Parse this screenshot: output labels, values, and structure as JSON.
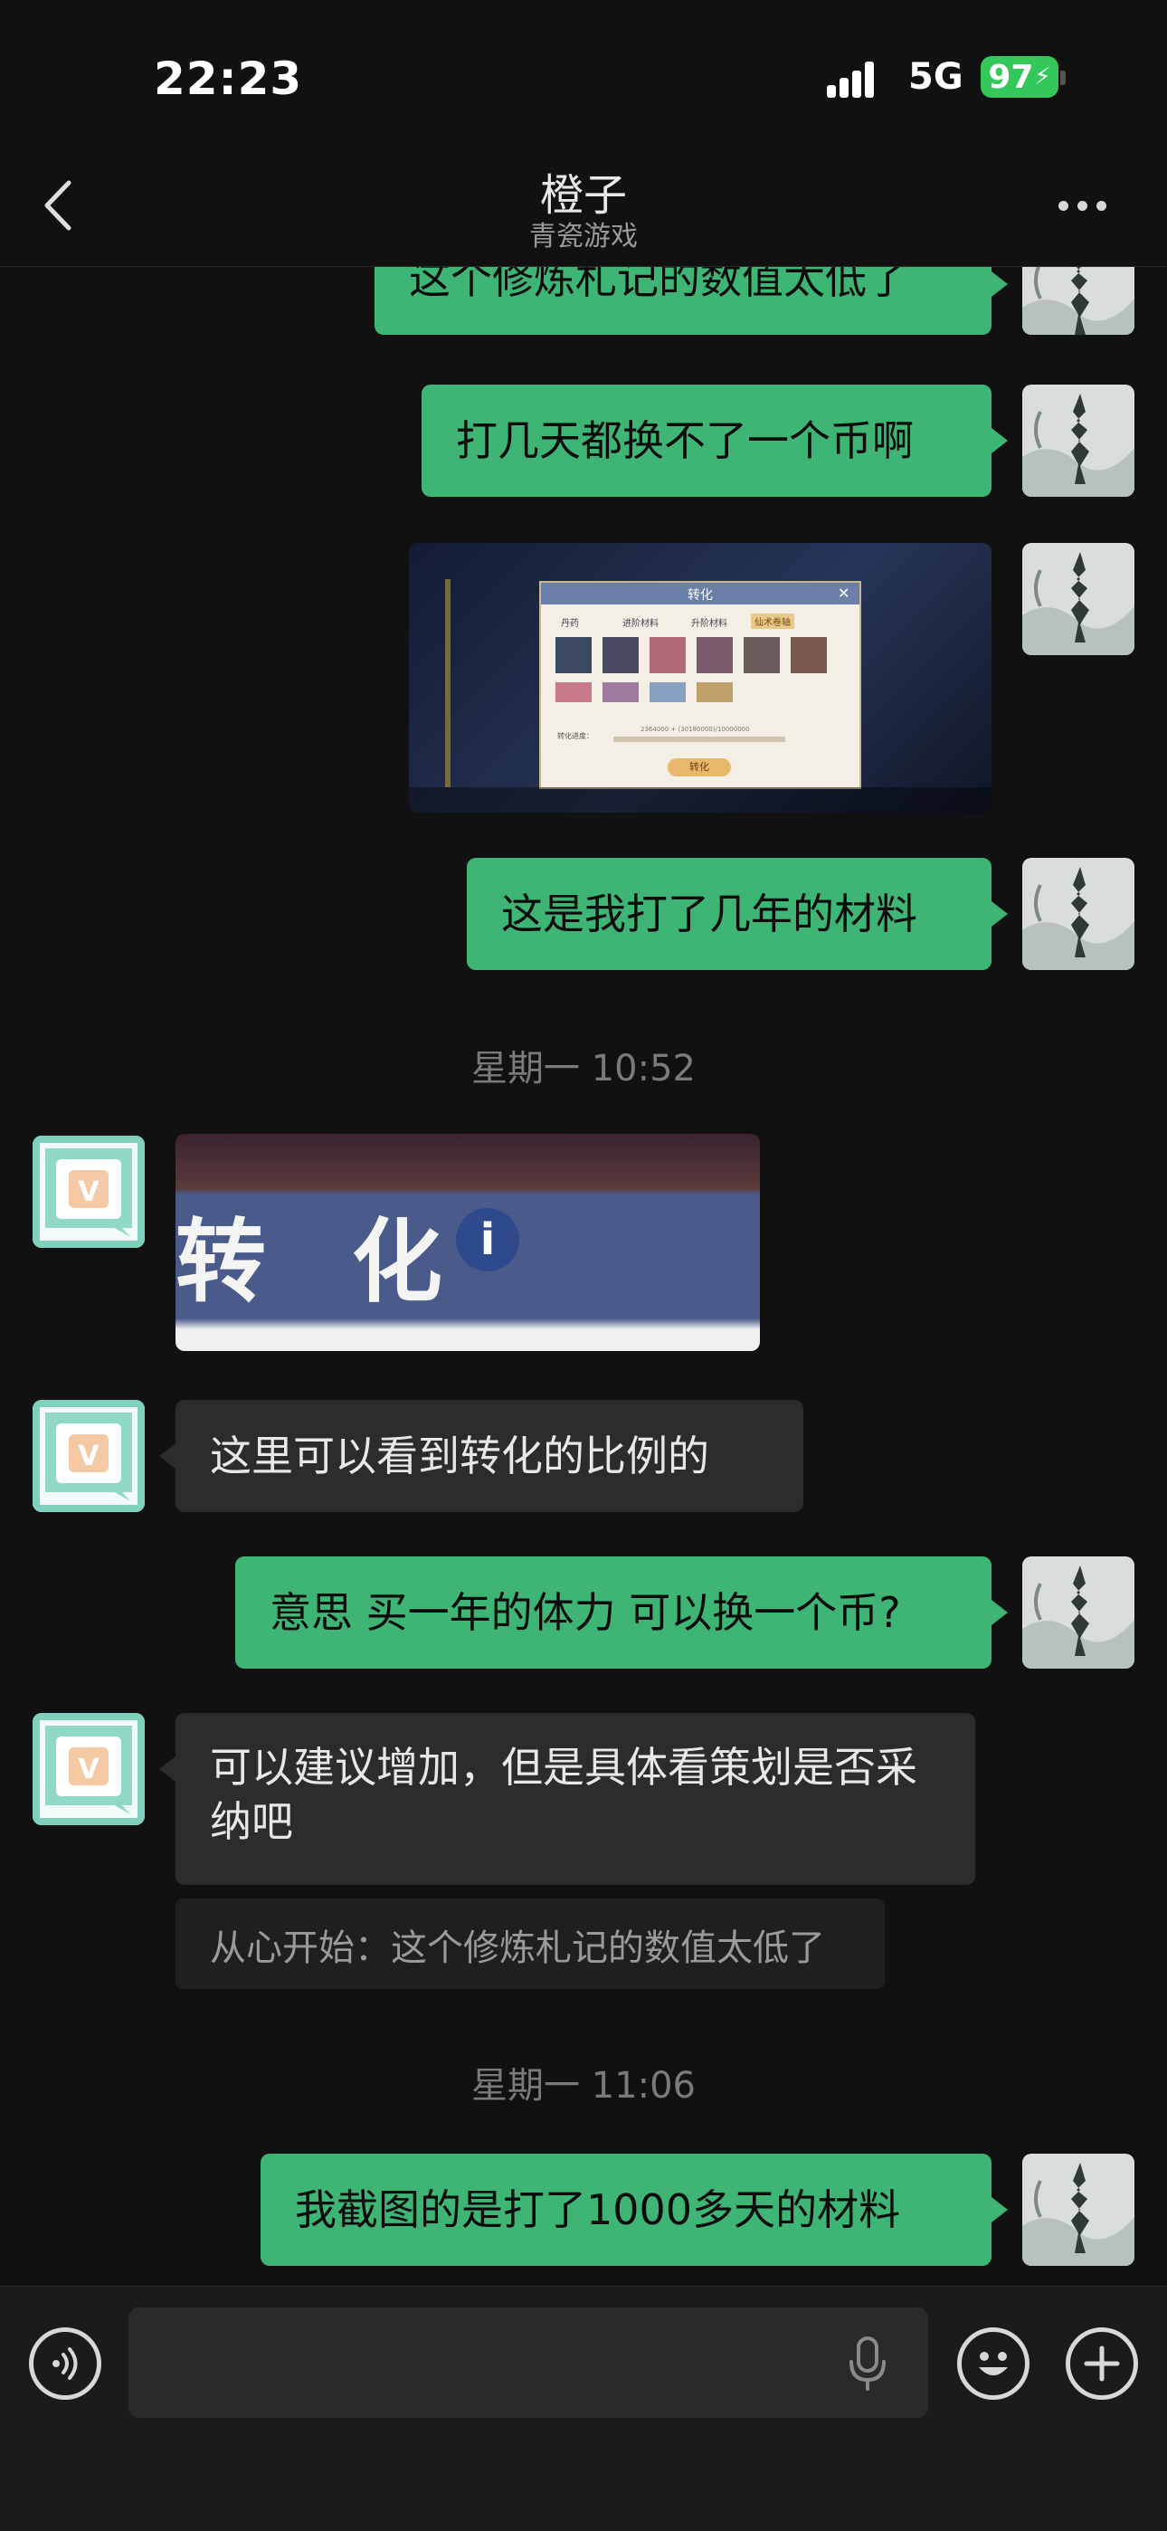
{
  "status_bar": {
    "time": "22:23",
    "network": "5G",
    "battery": "97"
  },
  "header": {
    "title": "橙子",
    "subtitle": "青瓷游戏"
  },
  "messages": [
    {
      "text": "这个修炼札记的数值太低了"
    },
    {
      "text": "打几天都换不了一个币啊"
    },
    {
      "image": "game-screenshot",
      "dialog_title": "转化",
      "tabs": [
        "丹药",
        "进阶材料",
        "升阶材料",
        "仙术卷轴"
      ],
      "progress_label": "转化进度：",
      "progress_text": "2364000 + (30180000)/10000000",
      "button": "转化"
    },
    {
      "text": "这是我打了几年的材料"
    },
    {
      "timestamp": "星期一 10:52"
    },
    {
      "image": "zoomed-screenshot",
      "caption": "转 化"
    },
    {
      "text": "这里可以看到转化的比例的"
    },
    {
      "text": "意思 买一年的体力 可以换一个币?"
    },
    {
      "text": "可以建议增加，但是具体看策划是否采纳吧"
    },
    {
      "quote": "从心开始：这个修炼札记的数值太低了"
    },
    {
      "timestamp": "星期一 11:06"
    },
    {
      "text": "我截图的是打了1000多天的材料"
    }
  ],
  "input_bar": {
    "voice_icon": "voice-icon",
    "mic_icon": "microphone-icon",
    "emoji_icon": "emoji-icon",
    "plus_icon": "plus-icon"
  },
  "colors": {
    "outgoing": "#3eb575",
    "incoming": "#2c2c2c",
    "background": "#111111"
  }
}
